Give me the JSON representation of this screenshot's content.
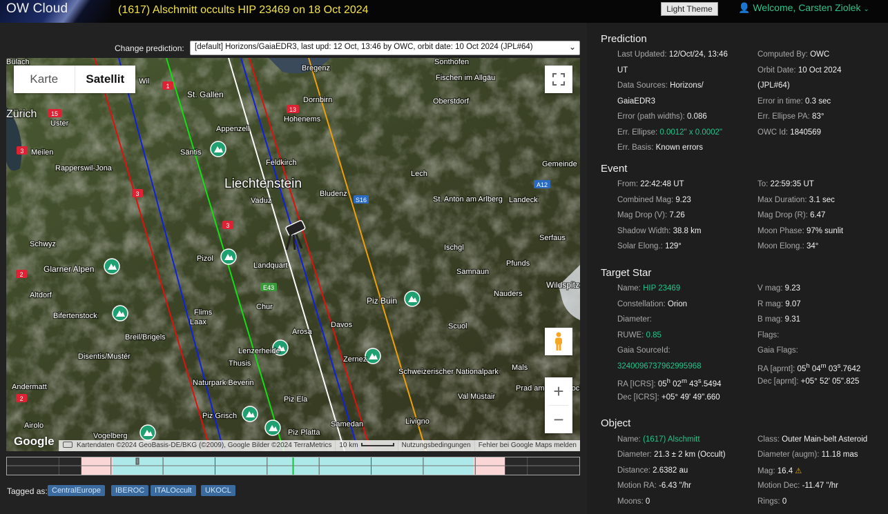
{
  "header": {
    "brand": "OW Cloud",
    "title": "(1617) Alschmitt occults HIP 23469 on 18 Oct 2024",
    "theme_button": "Light Theme",
    "welcome": "Welcome, Carsten Ziolek"
  },
  "prediction_select": {
    "label": "Change prediction:",
    "selected": "[default] Horizons/GaiaEDR3, last upd: 12 Oct, 13:46 by OWC, orbit date: 10 Oct 2024 (JPL#64)"
  },
  "map": {
    "type_buttons": [
      "Karte",
      "Satellit"
    ],
    "active_type": "Satellit",
    "google_logo": "Google",
    "attribution": {
      "map_data": "Kartendaten ©2024 GeoBasis-DE/BKG (©2009), Google Bilder ©2024 TerraMetrics",
      "scale": "10 km",
      "terms": "Nutzungsbedingungen",
      "report": "Fehler bei Google Maps melden"
    },
    "country_label": "Liechtenstein",
    "places": [
      "Bülach",
      "Wil",
      "St. Gallen",
      "Bregenz",
      "Sonthofen",
      "Fischen im Allgäu",
      "Oberstdorf",
      "Dornbirn",
      "Hohenems",
      "Appenzell",
      "Zürich",
      "Uster",
      "Meilen",
      "Rapperswil-Jona",
      "Säntis",
      "Feldkirch",
      "Lech",
      "Gemeinde",
      "Bludenz",
      "Vaduz",
      "St. Anton am Arlberg",
      "Landeck",
      "Schwyz",
      "Pizol",
      "Landquart",
      "Ischgl",
      "Serfaus",
      "Glarner Alpen",
      "Pfunds",
      "Samnaun",
      "Wildspitze",
      "Altdorf",
      "Chur",
      "Piz Buin",
      "Nauders",
      "Bifertenstock",
      "Flims",
      "Laax",
      "Davos",
      "Scuol",
      "Breil/Brigels",
      "Arosa",
      "Disentis/Mustér",
      "Lenzerheide",
      "Zernez",
      "Thusis",
      "Schweizerischer Nationalpark",
      "Mals",
      "Andermatt",
      "Naturpark Beverin",
      "Prad am Stilfserjoch",
      "Piz Ela",
      "Val Müstair",
      "Livigno",
      "Airolo",
      "Piz Grisch",
      "Piz Platta",
      "Samedan",
      "Vogelberg"
    ],
    "road_shields": [
      "1",
      "15",
      "3",
      "13",
      "3",
      "A12",
      "S16",
      "3",
      "E43",
      "2",
      "2"
    ]
  },
  "timeline": {
    "track_fraction": [
      0.13,
      0.87
    ],
    "inner_fraction": [
      0.185,
      0.815
    ],
    "center_fraction": 0.5,
    "cursor_fraction": 0.228
  },
  "tags": {
    "label": "Tagged as:",
    "items": [
      "CentralEurope",
      "IBEROC",
      "ITALOccult",
      "UKOCL"
    ]
  },
  "panel": {
    "prediction": {
      "title": "Prediction",
      "last_updated_label": "Last Updated:",
      "last_updated_value": "12/Oct/24, 13:46",
      "last_updated_value2": "UT",
      "computed_by_label": "Computed By:",
      "computed_by_value": "OWC",
      "orbit_date_label": "Orbit Date:",
      "orbit_date_value": "10 Oct 2024",
      "orbit_date_value2": "(JPL#64)",
      "data_sources_label": "Data Sources:",
      "data_sources_value": "Horizons/",
      "data_sources_value2": "GaiaEDR3",
      "error_time_label": "Error in time:",
      "error_time_value": "0.3 sec",
      "error_path_label": "Error (path widths):",
      "error_path_value": "0.086",
      "err_pa_label": "Err. Ellipse PA:",
      "err_pa_value": "83°",
      "err_ellipse_label": "Err. Ellipse:",
      "err_ellipse_value": "0.0012\" x 0.0002\"",
      "owc_id_label": "OWC Id:",
      "owc_id_value": "1840569",
      "err_basis_label": "Err. Basis:",
      "err_basis_value": "Known errors"
    },
    "event": {
      "title": "Event",
      "from_label": "From:",
      "from_value": "22:42:48 UT",
      "to_label": "To:",
      "to_value": "22:59:35 UT",
      "combined_mag_label": "Combined Mag:",
      "combined_mag_value": "9.23",
      "max_duration_label": "Max Duration:",
      "max_duration_value": "3.1 sec",
      "mag_drop_v_label": "Mag Drop (V):",
      "mag_drop_v_value": "7.26",
      "mag_drop_r_label": "Mag Drop (R):",
      "mag_drop_r_value": "6.47",
      "shadow_width_label": "Shadow Width:",
      "shadow_width_value": "38.8 km",
      "moon_phase_label": "Moon Phase:",
      "moon_phase_value": "97% sunlit",
      "solar_elong_label": "Solar Elong.:",
      "solar_elong_value": "129°",
      "moon_elong_label": "Moon Elong.:",
      "moon_elong_value": "34°"
    },
    "target_star": {
      "title": "Target Star",
      "name_label": "Name:",
      "name_value": "HIP 23469",
      "v_mag_label": "V mag:",
      "v_mag_value": "9.23",
      "constellation_label": "Constellation:",
      "constellation_value": "Orion",
      "r_mag_label": "R mag:",
      "r_mag_value": "9.07",
      "diameter_label": "Diameter:",
      "b_mag_label": "B mag:",
      "b_mag_value": "9.31",
      "ruwe_label": "RUWE:",
      "ruwe_value": "0.85",
      "flags_label": "Flags:",
      "gaia_source_label": "Gaia SourceId:",
      "gaia_flags_label": "Gaia Flags:",
      "gaia_source_value": "3240096737962995968",
      "ra_aprnt_label": "RA [aprnt]:",
      "ra_aprnt_value": "05h 04m 03s.7642",
      "ra_icrs_label": "RA [ICRS]:",
      "ra_icrs_value": "05h 02m 43s.5494",
      "dec_aprnt_label": "Dec [aprnt]:",
      "dec_aprnt_value": "+05° 52' 05\".825",
      "dec_icrs_label": "Dec [ICRS]:",
      "dec_icrs_value": "+05° 49' 49\".660"
    },
    "object": {
      "title": "Object",
      "name_label": "Name:",
      "name_value": "(1617) Alschmitt",
      "class_label": "Class:",
      "class_value": "Outer Main-belt Asteroid",
      "diameter_label": "Diameter:",
      "diameter_value": "21.3 ± 2 km",
      "diameter_note": "(Occult)",
      "diameter_augm_label": "Diameter (augm):",
      "diameter_augm_value": "11.18 mas",
      "distance_label": "Distance:",
      "distance_value": "2.6382 au",
      "mag_label": "Mag:",
      "mag_value": "16.4",
      "motion_ra_label": "Motion RA:",
      "motion_ra_value": "-6.43 \"/hr",
      "motion_dec_label": "Motion Dec:",
      "motion_dec_value": "-11.47 \"/hr",
      "moons_label": "Moons:",
      "moons_value": "0",
      "rings_label": "Rings:",
      "rings_value": "0"
    }
  },
  "colors": {
    "accent_green": "#23c48a",
    "title_yellow": "#f2e24a",
    "tag_blue": "#3a6a9e",
    "path_red": "#e01010",
    "path_blue": "#1020e0",
    "path_green": "#10e010",
    "path_white": "#ffffff",
    "path_orange": "#f0a000"
  }
}
